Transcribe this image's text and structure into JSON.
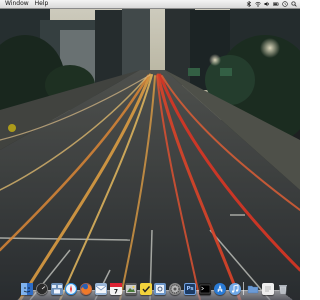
{
  "menubar": {
    "items": [
      {
        "label": "Window"
      },
      {
        "label": "Help"
      }
    ],
    "extras": [
      "bluetooth-icon",
      "wifi-icon",
      "volume-icon",
      "battery-icon",
      "clock-icon",
      "spotlight-icon"
    ]
  },
  "wallpaper": {
    "scene": "city-street-light-trails"
  },
  "dock": {
    "icons": [
      {
        "name": "finder-icon",
        "color": "#4a86d9"
      },
      {
        "name": "dashboard-icon",
        "color": "#3a3a3a"
      },
      {
        "name": "mission-control-icon",
        "color": "#6d8fb8"
      },
      {
        "name": "safari-icon",
        "color": "#2f8fe0"
      },
      {
        "name": "firefox-icon",
        "color": "#e5662a"
      },
      {
        "name": "mail-icon",
        "color": "#9bb7d8"
      },
      {
        "name": "calendar-icon",
        "color": "#f3f3f3"
      },
      {
        "name": "photo-icon",
        "color": "#5a5a5a"
      },
      {
        "name": "stickies-icon",
        "color": "#f2d23c"
      },
      {
        "name": "preview-icon",
        "color": "#6c95c7"
      },
      {
        "name": "system-preferences-icon",
        "color": "#8a8a8a"
      },
      {
        "name": "photoshop-icon",
        "color": "#1c3a63",
        "text": "Ps"
      },
      {
        "name": "terminal-icon",
        "color": "#1a1a1a"
      },
      {
        "name": "app-store-icon",
        "color": "#2a7bd6"
      },
      {
        "name": "itunes-icon",
        "color": "#6fa7e6"
      },
      {
        "name": "folder-icon",
        "color": "#6c9bd6"
      },
      {
        "name": "document-icon",
        "color": "#eeeeee"
      },
      {
        "name": "trash-icon",
        "color": "#b8bcc2"
      }
    ]
  }
}
